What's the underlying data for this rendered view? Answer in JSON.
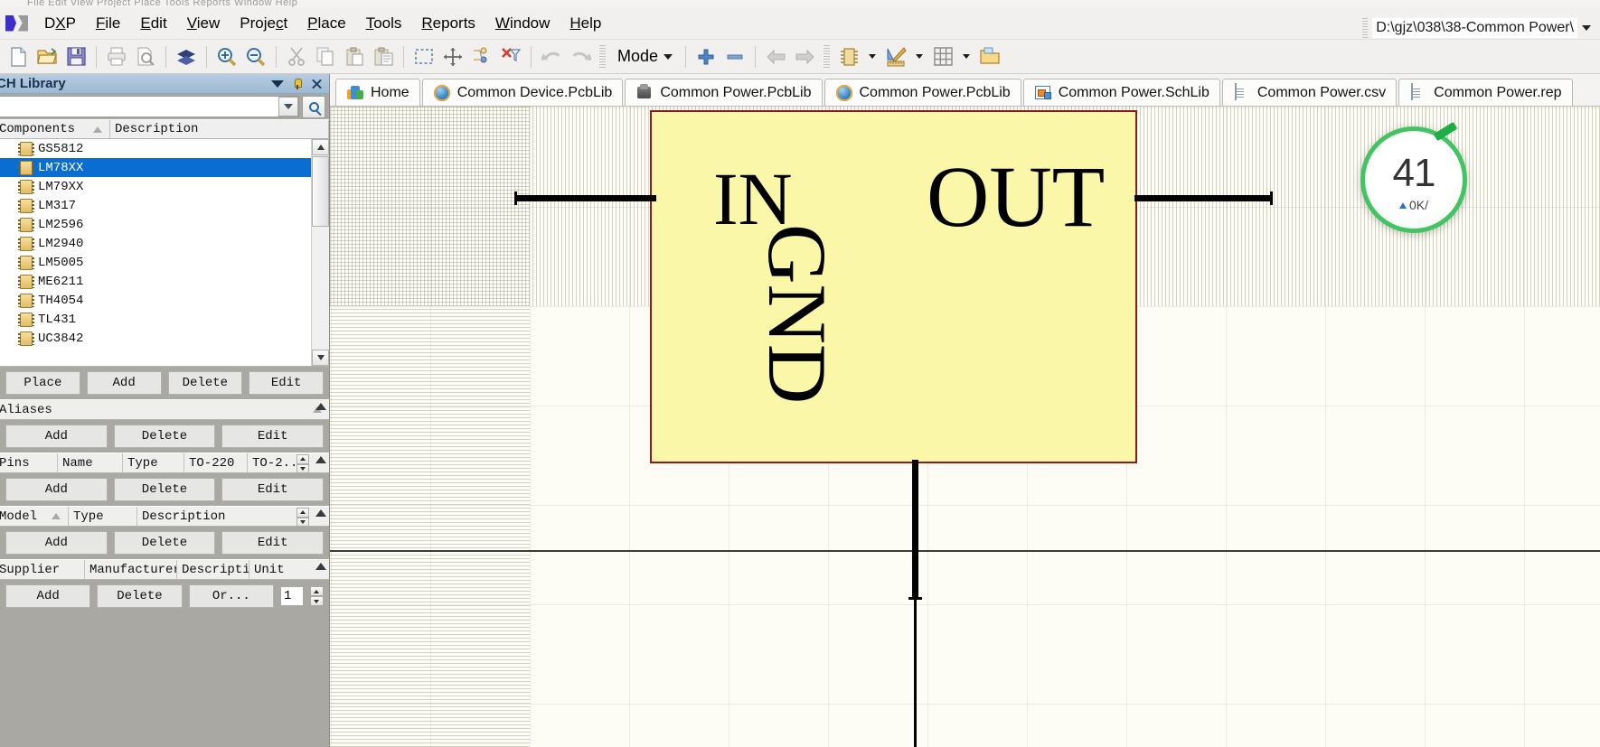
{
  "window": {
    "ghost_text": "File  Edit  View  Project  Place  Tools  Reports  Window  Help",
    "path": "D:\\gjz\\038\\38-Common Power\\"
  },
  "menu": {
    "items": [
      {
        "label": "DXP",
        "accel": "X"
      },
      {
        "label": "File",
        "accel": "F"
      },
      {
        "label": "Edit",
        "accel": "E"
      },
      {
        "label": "View",
        "accel": "V"
      },
      {
        "label": "Project",
        "accel": "c"
      },
      {
        "label": "Place",
        "accel": "P"
      },
      {
        "label": "Tools",
        "accel": "T"
      },
      {
        "label": "Reports",
        "accel": "R"
      },
      {
        "label": "Window",
        "accel": "W"
      },
      {
        "label": "Help",
        "accel": "H"
      }
    ]
  },
  "toolbar": {
    "mode_label": "Mode",
    "buttons": [
      "new-document-icon",
      "open-folder-icon",
      "save-icon",
      "print-icon",
      "print-preview-icon",
      "layers-icon",
      "zoom-in-icon",
      "zoom-out-icon",
      "cut-icon",
      "copy-icon",
      "paste-icon",
      "paste-special-icon",
      "select-area-icon",
      "move-icon",
      "smart-paste-icon",
      "clear-filter-icon",
      "undo-icon",
      "redo-icon",
      "add-icon",
      "remove-icon",
      "back-icon",
      "forward-icon",
      "component-icon",
      "draw-tools-icon",
      "grid-icon",
      "browse-icon"
    ]
  },
  "tabs": [
    {
      "label": "Home",
      "icon": "home-icon",
      "active": false
    },
    {
      "label": "Common Device.PcbLib",
      "icon": "ie-icon",
      "active": false
    },
    {
      "label": "Common Power.PcbLib",
      "icon": "pcb-icon",
      "active": false
    },
    {
      "label": "Common Power.PcbLib",
      "icon": "ie-icon",
      "active": false
    },
    {
      "label": "Common Power.SchLib",
      "icon": "schlib-icon",
      "active": true
    },
    {
      "label": "Common Power.csv",
      "icon": "doc-icon",
      "active": false
    },
    {
      "label": "Common Power.rep",
      "icon": "doc-icon",
      "active": false
    }
  ],
  "panel": {
    "title": "CH Library",
    "search_value": "",
    "components": {
      "columns": [
        "Components",
        "Description"
      ],
      "items": [
        {
          "name": "GS5812",
          "selected": false
        },
        {
          "name": "LM78XX",
          "selected": true
        },
        {
          "name": "LM79XX",
          "selected": false
        },
        {
          "name": "LM317",
          "selected": false
        },
        {
          "name": "LM2596",
          "selected": false
        },
        {
          "name": "LM2940",
          "selected": false
        },
        {
          "name": "LM5005",
          "selected": false
        },
        {
          "name": "ME6211",
          "selected": false
        },
        {
          "name": "TH4054",
          "selected": false
        },
        {
          "name": "TL431",
          "selected": false
        },
        {
          "name": "UC3842",
          "selected": false
        }
      ],
      "buttons": [
        "Place",
        "Add",
        "Delete",
        "Edit"
      ]
    },
    "aliases": {
      "title": "Aliases",
      "buttons": [
        "Add",
        "Delete",
        "Edit"
      ]
    },
    "pins": {
      "columns": [
        "Pins",
        "Name",
        "Type",
        "TO-220",
        "TO-2..."
      ],
      "buttons": [
        "Add",
        "Delete",
        "Edit"
      ]
    },
    "model": {
      "columns": [
        "Model",
        "Type",
        "Description"
      ],
      "buttons": [
        "Add",
        "Delete",
        "Edit"
      ]
    },
    "supplier": {
      "columns": [
        "Supplier",
        "Manufacturer",
        "Descripti",
        "Unit"
      ],
      "buttons": [
        "Add",
        "Delete",
        "Or..."
      ],
      "quantity": "1"
    }
  },
  "schematic": {
    "symbol": {
      "name": "LM78XX",
      "body_color": "#FBF7A8",
      "border_color": "#8E1B17",
      "labels": [
        {
          "text": "IN",
          "rotation": 0
        },
        {
          "text": "OUT",
          "rotation": 0
        },
        {
          "text": "GND",
          "rotation": 90
        }
      ]
    },
    "pins": [
      "input-pin",
      "output-pin",
      "ground-pin"
    ]
  },
  "speed_widget": {
    "value": "41",
    "rate": "0K/",
    "accent_color": "#43C463"
  }
}
